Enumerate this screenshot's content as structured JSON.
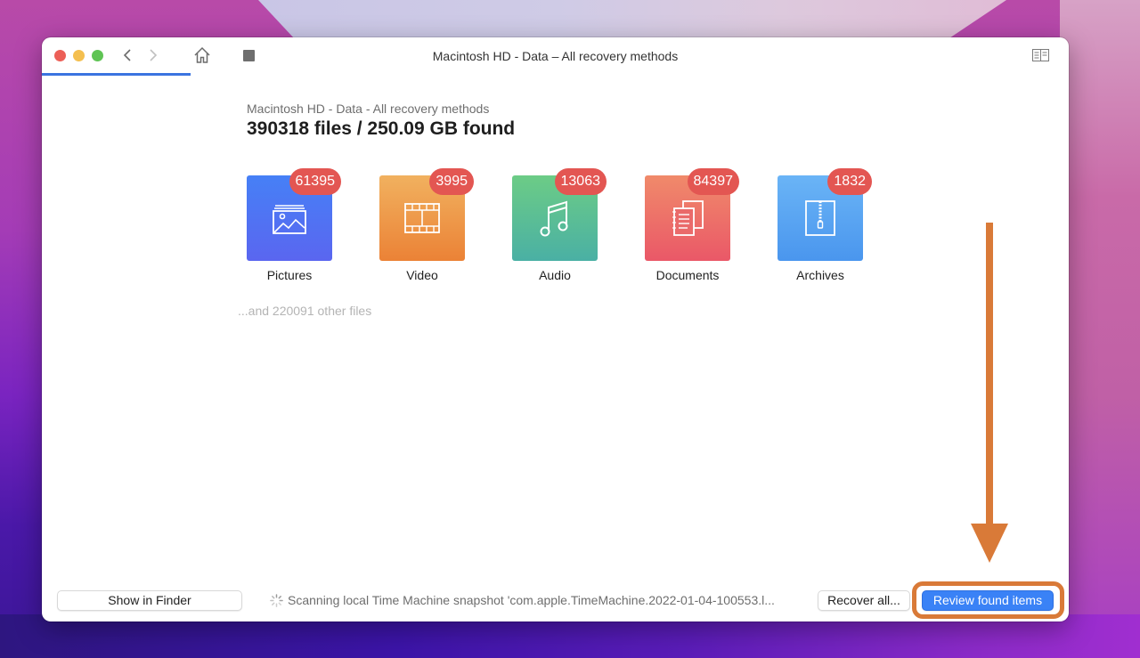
{
  "window": {
    "title": "Macintosh HD - Data – All recovery methods",
    "scan_progress_percent": 14.5
  },
  "toolbar": {
    "back_icon": "chevron-left",
    "forward_icon": "chevron-right",
    "home_icon": "house",
    "stop_icon": "stop-square",
    "sidebar_icon": "book-sidebar"
  },
  "summary": {
    "subtitle": "Macintosh HD - Data - All recovery methods",
    "headline": "390318 files / 250.09 GB found"
  },
  "categories": [
    {
      "label": "Pictures",
      "count": "61395",
      "icon": "picture-icon",
      "color_top": "#4680f6",
      "color_bottom": "#5a66f0"
    },
    {
      "label": "Video",
      "count": "3995",
      "icon": "film-icon",
      "color_top": "#f1b15f",
      "color_bottom": "#eb8236"
    },
    {
      "label": "Audio",
      "count": "13063",
      "icon": "music-note-icon",
      "color_top": "#6ccc86",
      "color_bottom": "#4ab0a4"
    },
    {
      "label": "Documents",
      "count": "84397",
      "icon": "documents-icon",
      "color_top": "#f08a6a",
      "color_bottom": "#ea5868"
    },
    {
      "label": "Archives",
      "count": "1832",
      "icon": "zip-archive-icon",
      "color_top": "#6ab4f6",
      "color_bottom": "#4a96ee"
    }
  ],
  "other_files": "...and 220091 other files",
  "footer": {
    "show_in_finder": "Show in Finder",
    "status": "Scanning local Time Machine snapshot 'com.apple.TimeMachine.2022-01-04-100553.l...",
    "recover_all": "Recover all...",
    "review_found_items": "Review found items"
  },
  "annotation": {
    "color": "#d97a38"
  }
}
